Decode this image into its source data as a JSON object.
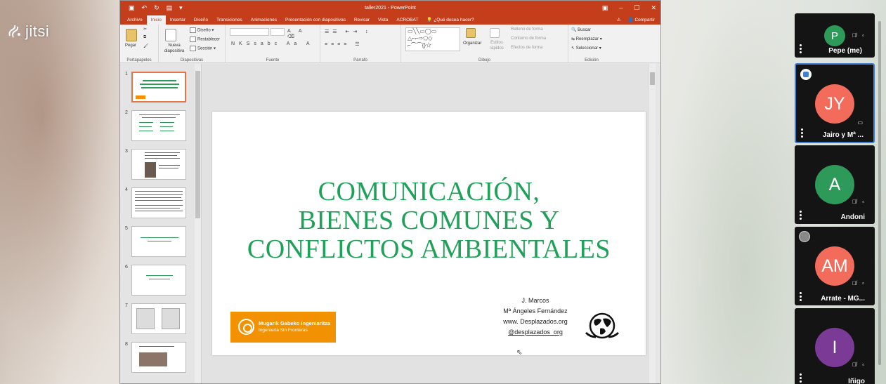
{
  "app": {
    "brand": "jitsi",
    "window_title": "taller2021 - PowerPoint"
  },
  "ppt": {
    "tabs": [
      "Archivo",
      "Inicio",
      "Insertar",
      "Diseño",
      "Transiciones",
      "Animaciones",
      "Presentación con diapositivas",
      "Revisar",
      "Vista",
      "ACROBAT"
    ],
    "active_tab": "Inicio",
    "tell_me": "¿Qué desea hacer?",
    "share": "Compartir",
    "ribbon": {
      "portapapeles": {
        "label": "Portapapeles",
        "paste": "Pegar"
      },
      "diapositivas": {
        "label": "Diapositivas",
        "new_slide": "Nueva diapositiva",
        "layout": "Diseño",
        "reset": "Restablecer",
        "section": "Sección"
      },
      "fuente": {
        "label": "Fuente"
      },
      "parrafo": {
        "label": "Párrafo"
      },
      "dibujo": {
        "label": "Dibujo",
        "arrange": "Organizar",
        "quick_styles": "Estilos rápidos",
        "fill": "Relleno de forma",
        "outline": "Contorno de forma",
        "effects": "Efectos de forma"
      },
      "edicion": {
        "label": "Edición",
        "find": "Buscar",
        "replace": "Reemplazar",
        "select": "Seleccionar"
      }
    },
    "thumbnails": [
      {
        "num": "1",
        "title": "COMUNICACIÓN, BIENES COMUNES Y CONFLICTOS AMBIENTALES"
      },
      {
        "num": "2",
        "title": "¿Qué tres ejemplos hay de periodismo y comunicación ambiental?"
      },
      {
        "num": "3",
        "title": ""
      },
      {
        "num": "4",
        "title": ""
      },
      {
        "num": "5",
        "title": "¿Por qué es importante el periodismo?"
      },
      {
        "num": "6",
        "title": "¿Quién controla el periodismo?"
      },
      {
        "num": "7",
        "title": ""
      },
      {
        "num": "8",
        "title": ""
      }
    ],
    "slide": {
      "title_lines": [
        "COMUNICACIÓN,",
        "BIENES COMUNES Y",
        "CONFLICTOS AMBIENTALES"
      ],
      "logo_line1": "Mugarik Gabeko Ingeniaritza",
      "logo_line2": "Ingeniería Sin Fronteras",
      "credits": [
        "J. Marcos",
        "Mª Ángeles Fernández",
        "www. Desplazados.org",
        "@desplazados_org"
      ],
      "colors": {
        "title": "#20a15a",
        "logo": "#f39200"
      }
    }
  },
  "participants": [
    {
      "initials": "P",
      "name": "Pepe (me)",
      "color": "#2e9a5a"
    },
    {
      "initials": "JY",
      "name": "Jairo y Mª ...",
      "color": "#f26b5b"
    },
    {
      "initials": "A",
      "name": "Andoni",
      "color": "#2e9a5a"
    },
    {
      "initials": "AM",
      "name": "Arrate - MG...",
      "color": "#f26b5b"
    },
    {
      "initials": "I",
      "name": "Iñigo",
      "color": "#7a3a96"
    }
  ]
}
